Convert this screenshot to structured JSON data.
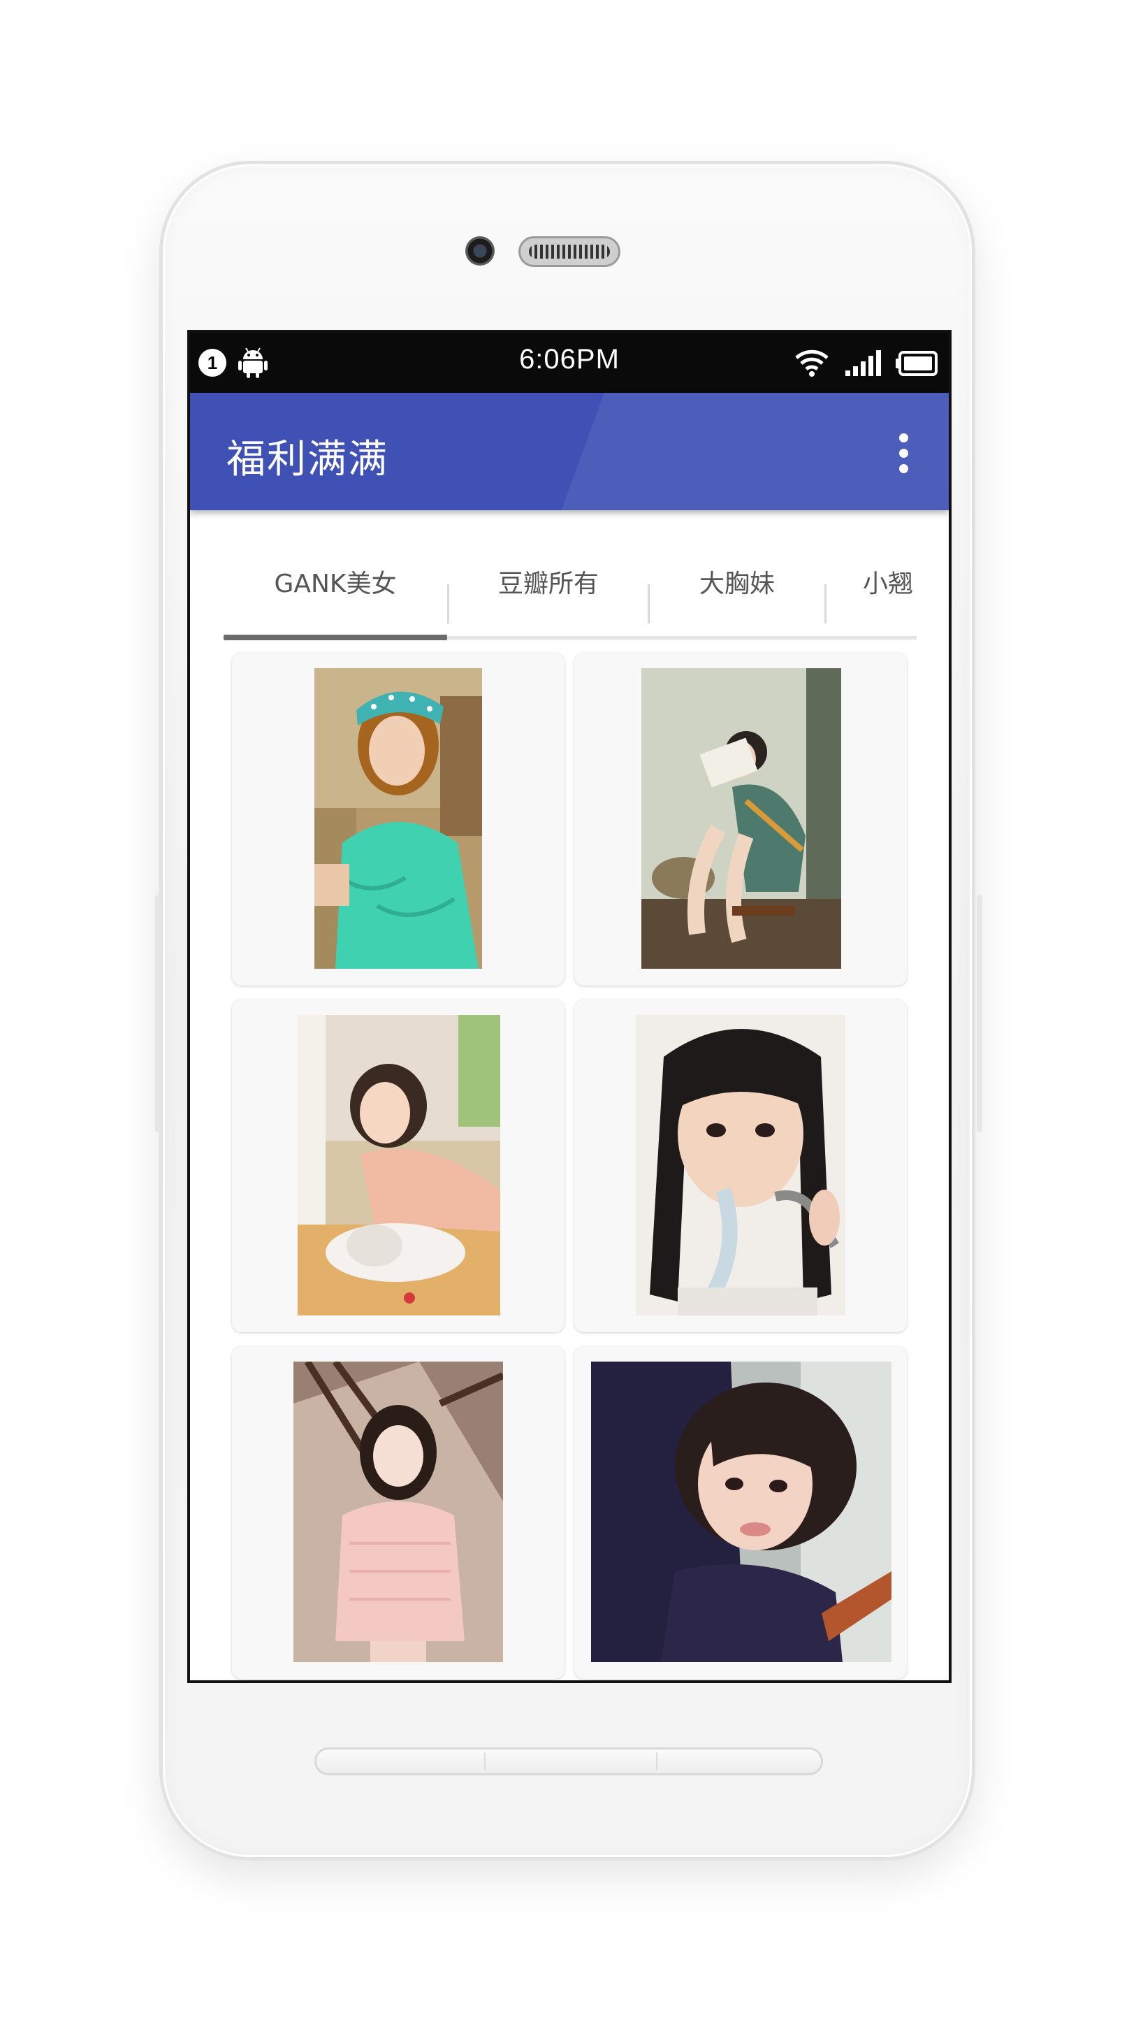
{
  "status_bar": {
    "notification_count": "1",
    "time": "6:06PM"
  },
  "app_bar": {
    "title": "福利满满",
    "color": "#3f51b5"
  },
  "tabs": [
    {
      "label": "GANK美女",
      "active": true
    },
    {
      "label": "豆瓣所有",
      "active": false
    },
    {
      "label": "大胸妹",
      "active": false
    },
    {
      "label": "小翘",
      "active": false
    }
  ],
  "photos": [
    {
      "alt": "girl in teal sweater with headband"
    },
    {
      "alt": "girl reading book on stool"
    },
    {
      "alt": "girl lying with cat in sunlight"
    },
    {
      "alt": "girl drinking from water tap"
    },
    {
      "alt": "girl in pink knit sweater on stairs"
    },
    {
      "alt": "girl in navy sweater selfie"
    }
  ],
  "icons": {
    "notification": "notification-badge-icon",
    "android": "android-icon",
    "wifi": "wifi-icon",
    "signal": "signal-icon",
    "battery": "battery-icon",
    "overflow": "more-vert-icon"
  }
}
